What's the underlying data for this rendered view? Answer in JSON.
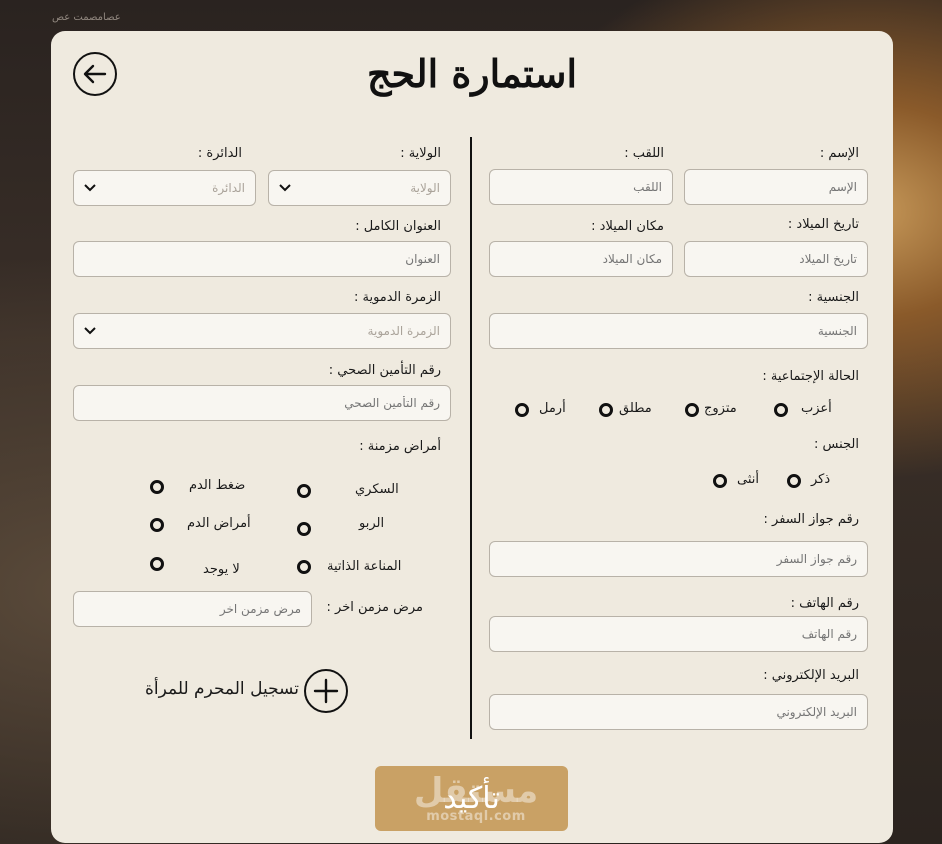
{
  "bg_watermark": "عصامصمت عص",
  "title": "استمارة الحج",
  "right": {
    "name_label": "الإسم :",
    "name_placeholder": "الإسم",
    "surname_label": "اللقب :",
    "surname_placeholder": "اللقب",
    "dob_label": "تاريخ الميلاد :",
    "dob_placeholder": "تاريخ الميلاد",
    "pob_label": "مكان الميلاد :",
    "pob_placeholder": "مكان الميلاد",
    "nationality_label": "الجنسية :",
    "nationality_placeholder": "الجنسية",
    "marital_label": "الحالة الإجتماعية :",
    "marital_options": [
      "أعزب",
      "متزوج",
      "مطلق",
      "أرمل"
    ],
    "gender_label": "الجنس :",
    "gender_options": [
      "ذكر",
      "أنثى"
    ],
    "passport_label": "رقم جواز السفر :",
    "passport_placeholder": "رقم جواز السفر",
    "phone_label": "رقم الهاتف :",
    "phone_placeholder": "رقم الهاتف",
    "email_label": "البريد الإلكتروني :",
    "email_placeholder": "البريد الإلكتروني"
  },
  "left": {
    "state_label": "الولاية :",
    "state_value": "الولاية",
    "district_label": "الدائرة :",
    "district_value": "الدائرة",
    "address_label": "العنوان الكامل :",
    "address_placeholder": "العنوان",
    "blood_label": "الزمرة الدموية :",
    "blood_value": "الزمرة الدموية",
    "insurance_label": "رقم التأمين الصحي :",
    "insurance_placeholder": "رقم التأمين الصحي",
    "chronic_label": "أمراض مزمنة :",
    "chronic_options": [
      "السكري",
      "ضغط الدم",
      "الربو",
      "أمراض الدم",
      "المناعة الذاتية",
      "لا يوجد"
    ],
    "other_label": "مرض مزمن اخر :",
    "other_placeholder": "مرض مزمن اخر",
    "mahram_label": "تسجيل المحرم للمرأة"
  },
  "confirm_label": "تأكيد",
  "watermark": {
    "arabic": "مستقل",
    "latin": "mostaql.com"
  },
  "colors": {
    "card": "#efeadf",
    "accent": "#c9a165"
  }
}
